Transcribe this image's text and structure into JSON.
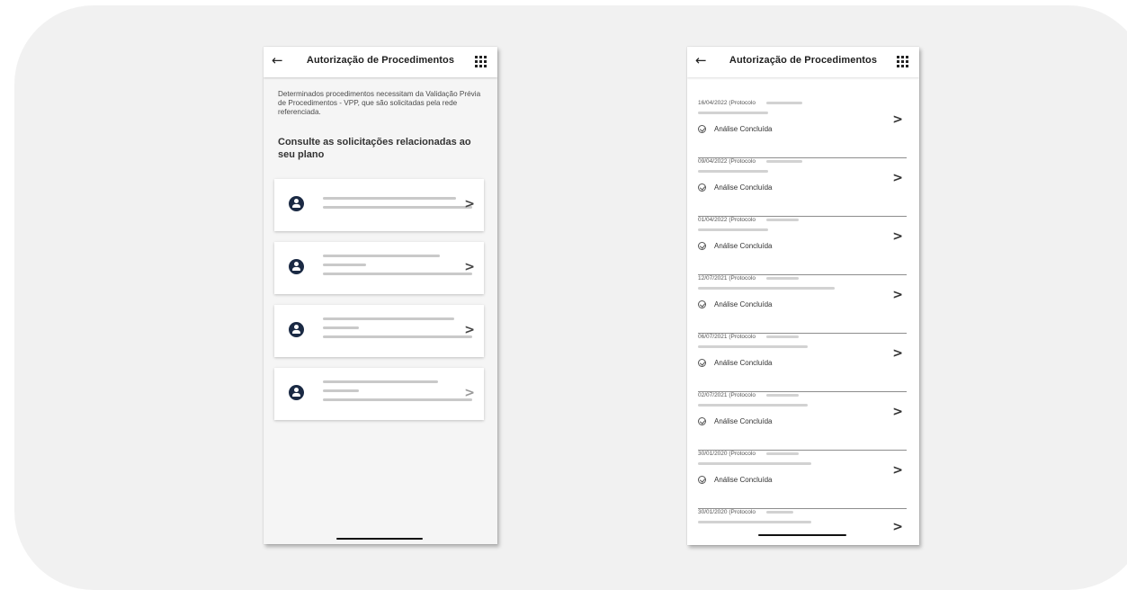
{
  "left_screen": {
    "title": "Autorização de Procedimentos",
    "back_glyph": "←",
    "intro": "Determinados procedimentos necessitam da Validação Prévia de Procedimentos - VPP, que são solicitadas pela rede referenciada.",
    "subhead": "Consulte as solicitações relacionadas ao seu plano",
    "chevron": ">",
    "cards_count_visible": 4,
    "icons": {
      "back": "arrow-left-icon",
      "menu": "grid-menu-icon",
      "avatar": "person-icon",
      "chevron": "chevron-right-icon"
    }
  },
  "right_screen": {
    "title": "Autorização de Procedimentos",
    "back_glyph": "←",
    "chevron": ">",
    "items": [
      {
        "date": "16/04/2022 (Protocolo",
        "status": "Análise Concluída"
      },
      {
        "date": "09/04/2022 (Protocolo",
        "status": "Análise Concluída"
      },
      {
        "date": "01/04/2022 (Protocolo",
        "status": "Análise Concluída"
      },
      {
        "date": "12/07/2021 (Protocolo",
        "status": "Análise Concluída"
      },
      {
        "date": "06/07/2021 (Protocolo",
        "status": "Análise Concluída"
      },
      {
        "date": "02/07/2021 (Protocolo",
        "status": "Análise Concluída"
      },
      {
        "date": "30/01/2020 (Protocolo",
        "status": "Análise Concluída"
      },
      {
        "date": "30/01/2020 (Protocolo",
        "status": ""
      }
    ]
  },
  "colors": {
    "avatar": "#1b2a44",
    "panel": "#f1f1f1",
    "divider": "#8d8d8d"
  }
}
